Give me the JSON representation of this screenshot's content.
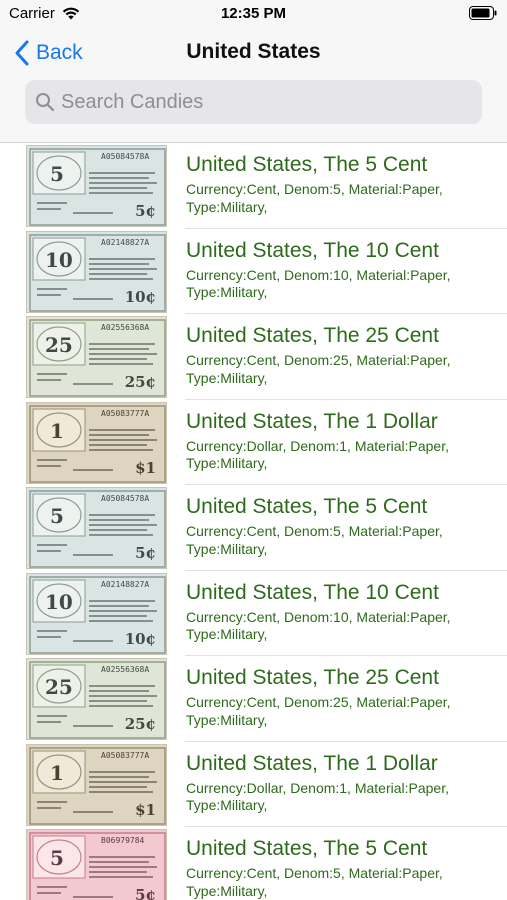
{
  "status_bar": {
    "carrier": "Carrier",
    "time": "12:35 PM"
  },
  "nav": {
    "back_label": "Back",
    "title": "United States"
  },
  "search": {
    "placeholder": "Search Candies",
    "value": ""
  },
  "colors": {
    "accent": "#1478f0",
    "item_text": "#2e6a1c"
  },
  "items": [
    {
      "title": "United States, The 5 Cent",
      "subtitle": "Currency:Cent, Denom:5, Material:Paper, Type:Military,",
      "note_value": "5",
      "note_corner": "5¢",
      "serial": "A05084578A",
      "palette": "blue"
    },
    {
      "title": "United States, The 10 Cent",
      "subtitle": "Currency:Cent, Denom:10, Material:Paper, Type:Military,",
      "note_value": "10",
      "note_corner": "10¢",
      "serial": "A02148827A",
      "palette": "blue"
    },
    {
      "title": "United States, The 25 Cent",
      "subtitle": "Currency:Cent, Denom:25, Material:Paper, Type:Military,",
      "note_value": "25",
      "note_corner": "25¢",
      "serial": "A02556368A",
      "palette": "green"
    },
    {
      "title": "United States, The 1 Dollar",
      "subtitle": "Currency:Dollar, Denom:1, Material:Paper, Type:Military,",
      "note_value": "1",
      "note_corner": "$1",
      "serial": "A05083777A",
      "palette": "tan"
    },
    {
      "title": "United States, The 5 Cent",
      "subtitle": "Currency:Cent, Denom:5, Material:Paper, Type:Military,",
      "note_value": "5",
      "note_corner": "5¢",
      "serial": "A05084578A",
      "palette": "blue"
    },
    {
      "title": "United States, The 10 Cent",
      "subtitle": "Currency:Cent, Denom:10, Material:Paper, Type:Military,",
      "note_value": "10",
      "note_corner": "10¢",
      "serial": "A02148827A",
      "palette": "blue"
    },
    {
      "title": "United States, The 25 Cent",
      "subtitle": "Currency:Cent, Denom:25, Material:Paper, Type:Military,",
      "note_value": "25",
      "note_corner": "25¢",
      "serial": "A02556368A",
      "palette": "green"
    },
    {
      "title": "United States, The 1 Dollar",
      "subtitle": "Currency:Dollar, Denom:1, Material:Paper, Type:Military,",
      "note_value": "1",
      "note_corner": "$1",
      "serial": "A05083777A",
      "palette": "tan"
    },
    {
      "title": "United States, The 5 Cent",
      "subtitle": "Currency:Cent, Denom:5, Material:Paper, Type:Military,",
      "note_value": "5",
      "note_corner": "5¢",
      "serial": "B06979784",
      "palette": "pink"
    }
  ]
}
